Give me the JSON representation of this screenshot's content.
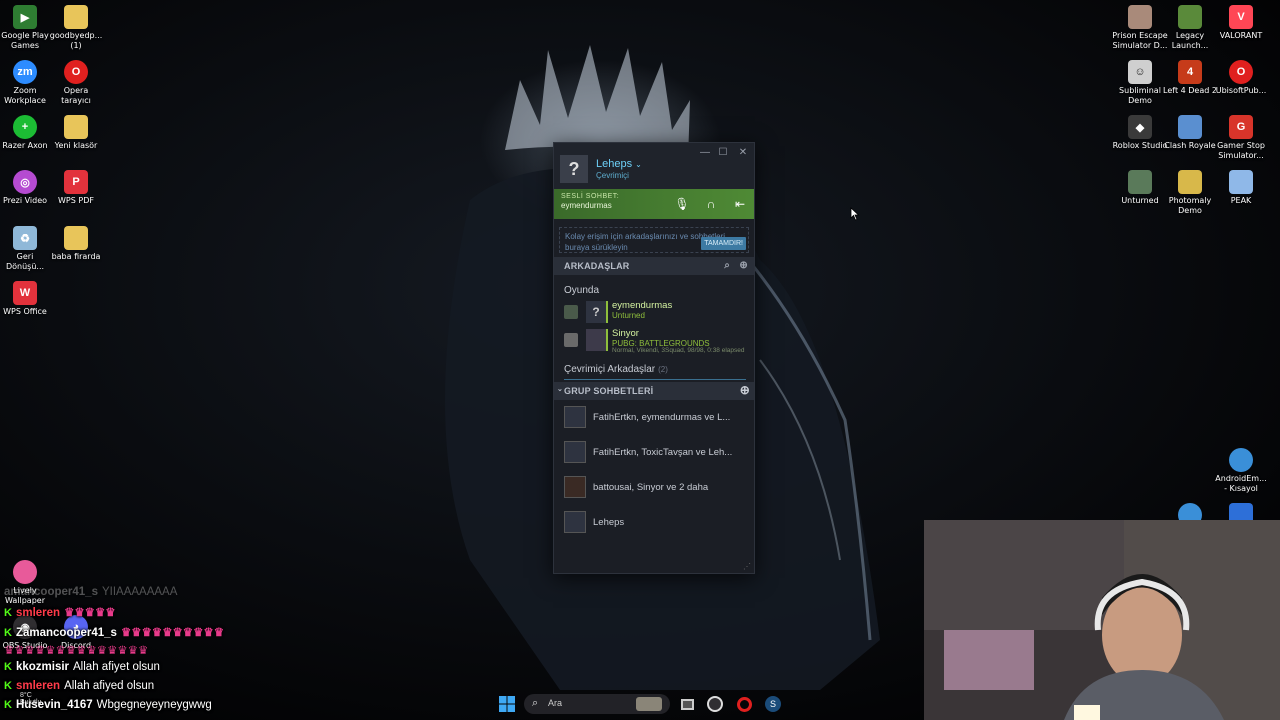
{
  "desktop": {
    "left_icons": [
      {
        "label": "Google Play Games",
        "icon": "google-play-games-icon",
        "color": "#2e7d32"
      },
      {
        "label": "goodbyedp... (1)",
        "icon": "folder-icon",
        "color": "#e8c55a"
      },
      {
        "label": "Zoom Workplace",
        "icon": "zoom-icon",
        "color": "#2d8cff"
      },
      {
        "label": "Opera tarayıcı",
        "icon": "opera-icon",
        "color": "#e0201f"
      },
      {
        "label": "Razer Axon",
        "icon": "razer-icon",
        "color": "#1cbc34"
      },
      {
        "label": "Yeni klasör",
        "icon": "folder-icon",
        "color": "#e8c55a"
      },
      {
        "label": "Prezi Video",
        "icon": "prezi-icon",
        "color": "#b54bd1"
      },
      {
        "label": "WPS PDF",
        "icon": "wps-pdf-icon",
        "color": "#e2323c"
      },
      {
        "label": "Geri Dönüşü...",
        "icon": "recycle-bin-icon",
        "color": "#8fb8d8"
      },
      {
        "label": "baba firarda",
        "icon": "folder-icon",
        "color": "#e8c55a"
      },
      {
        "label": "WPS Office",
        "icon": "wps-office-icon",
        "color": "#e2323c"
      }
    ],
    "right_icons": [
      {
        "label": "Prison Escape Simulator D...",
        "icon": "prison-escape-icon",
        "color": "#a98a7a"
      },
      {
        "label": "Legacy Launch...",
        "icon": "minecraft-icon",
        "color": "#5a8a3a"
      },
      {
        "label": "VALORANT",
        "icon": "valorant-icon",
        "color": "#ff4655"
      },
      {
        "label": "Subliminal Demo",
        "icon": "subliminal-icon",
        "color": "#cfcfcf"
      },
      {
        "label": "Left 4 Dead 2",
        "icon": "l4d2-icon",
        "color": "#c63b1a"
      },
      {
        "label": "UbisoftPub...",
        "icon": "opera-icon",
        "color": "#e0201f"
      },
      {
        "label": "Roblox Studio",
        "icon": "roblox-studio-icon",
        "color": "#3a3a3a"
      },
      {
        "label": "Clash Royale",
        "icon": "clash-royale-icon",
        "color": "#5a8fd0"
      },
      {
        "label": "Gamer Stop Simulator...",
        "icon": "gamer-stop-icon",
        "color": "#d8342a"
      },
      {
        "label": "Unturned",
        "icon": "unturned-icon",
        "color": "#5a7a5a"
      },
      {
        "label": "Photomaly Demo",
        "icon": "photomaly-icon",
        "color": "#d8b84a"
      },
      {
        "label": "PEAK",
        "icon": "peak-icon",
        "color": "#8fb8e8"
      }
    ],
    "other_icons": [
      {
        "label": "AndroidEm... - Kısayol",
        "icon": "android-emulator-icon",
        "color": "#3a8fd8"
      },
      {
        "label": "Lively Wallpaper",
        "icon": "lively-wallpaper-icon",
        "color": "#e85a9a"
      },
      {
        "label": "OBS Studio",
        "icon": "obs-icon",
        "color": "#302e31"
      },
      {
        "label": "Discord",
        "icon": "discord-icon",
        "color": "#5865f2"
      }
    ]
  },
  "steam": {
    "username": "Leheps",
    "status": "Çevrimiçi",
    "avatar_glyph": "?",
    "voice": {
      "title": "SESLİ SOHBET:",
      "channel": "eymendurmas"
    },
    "hint": {
      "text": "Kolay erişim için arkadaşlarınızı ve sohbetleri buraya sürükleyin",
      "button": "TAMAMDIR!"
    },
    "friends_header": "ARKADAŞLAR",
    "ingame_label": "Oyunda",
    "ingame": [
      {
        "name": "eymendurmas",
        "game": "Unturned",
        "detail": "",
        "avatar": "?"
      },
      {
        "name": "Sinyor",
        "game": "PUBG: BATTLEGROUNDS",
        "detail": "Normal, Vikendi, 3Squad, 98/98, 0:38 elapsed",
        "avatar": ""
      }
    ],
    "online_label": "Çevrimiçi Arkadaşlar",
    "online_count": "(2)",
    "groups_header": "GRUP SOHBETLERİ",
    "groups": [
      {
        "name": "FatihErtkn, eymendurmas ve L..."
      },
      {
        "name": "FatihErtkn, ToxicTavşan ve Leh..."
      },
      {
        "name": "battousai, Sinyor ve 2 daha"
      },
      {
        "name": "Leheps"
      }
    ]
  },
  "chat": [
    {
      "user": "amancooper41_s",
      "color": "#ffffff",
      "message": "YIIAAAAAAAA",
      "faded": true
    },
    {
      "user": "smleren",
      "color": "#ff3b4a",
      "message": "",
      "faded": false
    },
    {
      "user": "Zamancooper41_s",
      "color": "#ffffff",
      "message": "",
      "faded": false
    },
    {
      "user": "kkozmisir",
      "color": "#ffffff",
      "message": "Allah afiyet olsun",
      "faded": false
    },
    {
      "user": "smleren",
      "color": "#ff3b4a",
      "message": "Allah afiyed olsun",
      "faded": false
    },
    {
      "user": "Husevin_4167",
      "color": "#ffffff",
      "message": "Wbgegneyeyneygwwg",
      "faded": false
    }
  ],
  "weather": {
    "temp": "8°C",
    "desc": "Bulutlu"
  },
  "taskbar": {
    "search_placeholder": "Ara",
    "apps": [
      "windows-start-icon",
      "search-icon",
      "task-view-icon",
      "obs-icon",
      "opera-icon",
      "steam-icon"
    ]
  }
}
